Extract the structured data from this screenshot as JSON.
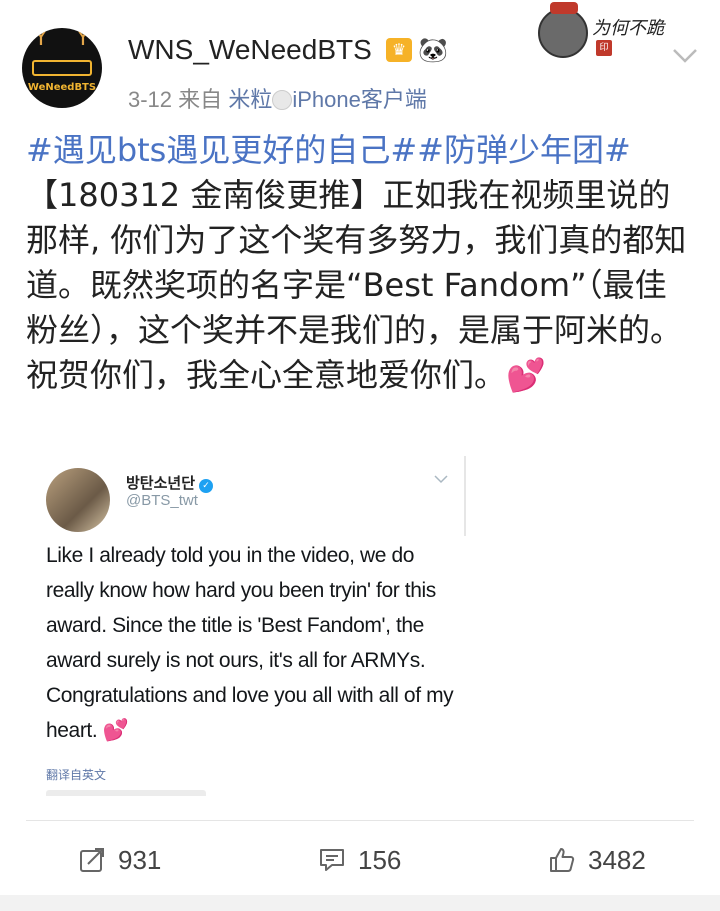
{
  "post": {
    "username": "WNS_WeNeedBTS",
    "avatar_logo_text": "WeNeedBTS",
    "date": "3-12",
    "from_label": "来自",
    "source": "米粒",
    "client": "iPhone客户端",
    "decoration_text": "为何不跪",
    "hashtags": "#遇见bts遇见更好的自己##防弹少年团#",
    "text": "【180312 金南俊更推】正如我在视频里说的那样, 你们为了这个奖有多努力，我们真的都知道。既然奖项的名字是“Best Fandom”（最佳粉丝），这个奖并不是我们的，是属于阿米的。祝贺你们，我全心全意地爱你们。",
    "emoji": "💕"
  },
  "embed": {
    "name": "방탄소년단",
    "handle": "@BTS_twt",
    "text": "Like I already told you in the video, we do really know how hard you been tryin' for this award. Since the title is 'Best Fandom', the award surely is not ours, it's all for ARMYs. Congratulations and love you all with all of my heart.",
    "emoji": "💕",
    "translate_label": "翻译自英文"
  },
  "actions": {
    "repost_count": "931",
    "comment_count": "156",
    "like_count": "3482"
  },
  "colors": {
    "link": "#4a73c4",
    "source": "#5f78a8",
    "crown_badge": "#f6b227",
    "heart": "#e0245e"
  },
  "icons": {
    "repost": "repost-icon",
    "comment": "comment-icon",
    "like": "thumbs-up-icon",
    "more": "chevron-down-icon"
  }
}
